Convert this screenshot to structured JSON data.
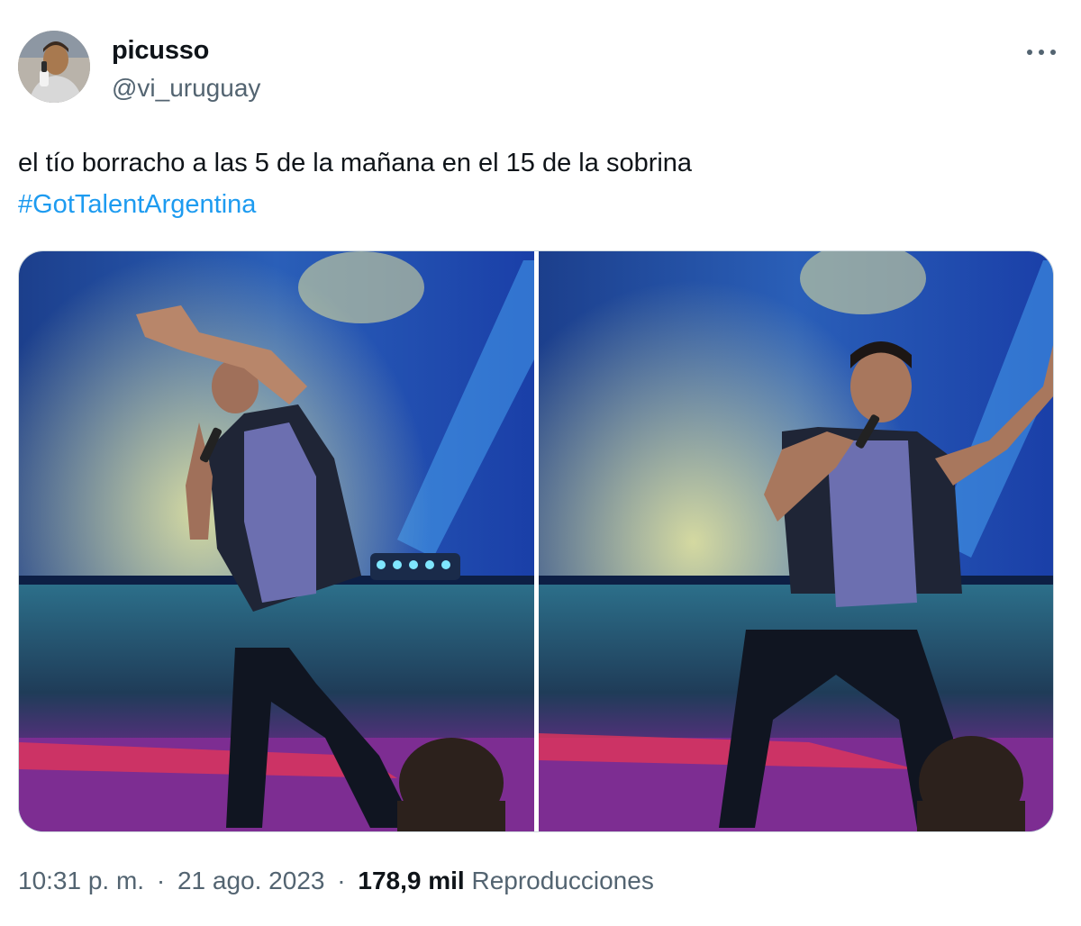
{
  "tweet": {
    "author": {
      "display_name": "picusso",
      "handle": "@vi_uruguay",
      "avatar_icon": "avatar-photo"
    },
    "more_icon": "more-options-icon",
    "text_line1": "el tío borracho a las 5 de la mañana en el 15 de la sobrina",
    "hashtag": "#GotTalentArgentina",
    "media": [
      {
        "kind": "photo",
        "description_icon": "stage-performer-photo"
      },
      {
        "kind": "photo",
        "description_icon": "stage-performer-photo"
      }
    ],
    "time": "10:31 p. m.",
    "separator": "·",
    "date": "21 ago. 2023",
    "views_count": "178,9 mil",
    "views_label": "Reproducciones"
  },
  "colors": {
    "link": "#1d9bf0",
    "secondary_text": "#536471",
    "primary_text": "#0f1419"
  }
}
